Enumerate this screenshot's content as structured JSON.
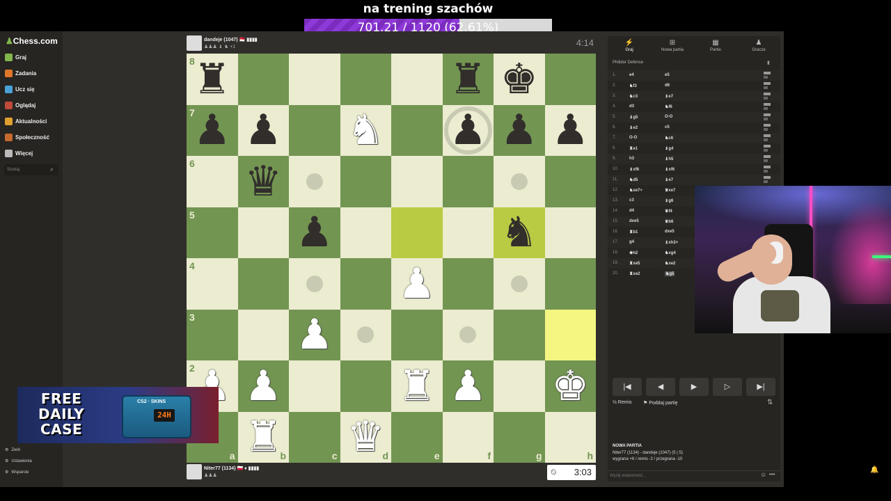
{
  "goal": {
    "title": "na trening szachów",
    "text": "701.21 / 1120 (62.61%)",
    "progress_fraction": 0.6261
  },
  "sidebar": {
    "logo": "Chess.com",
    "items": [
      {
        "label": "Graj",
        "icon": "play-icon",
        "color": "#81b64c"
      },
      {
        "label": "Zadania",
        "icon": "puzzle-icon",
        "color": "#e0762a"
      },
      {
        "label": "Ucz się",
        "icon": "learn-icon",
        "color": "#4aa3d8"
      },
      {
        "label": "Oglądaj",
        "icon": "watch-icon",
        "color": "#c04a3a"
      },
      {
        "label": "Aktualności",
        "icon": "news-icon",
        "color": "#e0a030"
      },
      {
        "label": "Społeczność",
        "icon": "social-icon",
        "color": "#c46a2e"
      },
      {
        "label": "Więcej",
        "icon": "more-icon",
        "color": "#bbbbbb"
      }
    ],
    "search_placeholder": "Szukaj",
    "footer": [
      {
        "label": "Zwiń",
        "icon": "collapse-icon"
      },
      {
        "label": "Ustawienia",
        "icon": "settings-icon"
      },
      {
        "label": "Wsparcie",
        "icon": "help-icon"
      }
    ]
  },
  "top_player": {
    "name": "dandeje (1047) 🇲🇨 ▮▮▮▮",
    "captured": "♟♟♟ ♝ ♞ +1",
    "clock": "4:14"
  },
  "bottom_player": {
    "name": "Niter77 (1134) 🇵🇱 ♦ ▮▮▮▮",
    "captured": "♟♟♟",
    "clock": "3:03"
  },
  "board": {
    "ranks": [
      "8",
      "7",
      "6",
      "5",
      "4",
      "3",
      "2",
      "1"
    ],
    "files": [
      "a",
      "b",
      "c",
      "d",
      "e",
      "f",
      "g",
      "h"
    ],
    "rows": [
      [
        "br",
        "",
        "",
        "",
        "",
        "br",
        "bk",
        ""
      ],
      [
        "bp",
        "bp",
        "",
        "wn",
        "",
        "bp",
        "bp",
        "bp"
      ],
      [
        "",
        "bq",
        "",
        "",
        "",
        "",
        "",
        ""
      ],
      [
        "",
        "",
        "bp",
        "",
        "",
        "",
        "bn",
        ""
      ],
      [
        "",
        "",
        "",
        "",
        "wp",
        "",
        "",
        ""
      ],
      [
        "",
        "",
        "wp",
        "",
        "",
        "",
        "",
        ""
      ],
      [
        "wp",
        "wp",
        "",
        "",
        "wr",
        "wp",
        "",
        "wk"
      ],
      [
        "",
        "wr",
        "",
        "wq",
        "",
        "",
        "",
        ""
      ]
    ],
    "highlights": [
      [
        "5",
        "e",
        "hl-dark"
      ],
      [
        "5",
        "g",
        "hl-dark"
      ],
      [
        "3",
        "h",
        "hl-light"
      ]
    ],
    "dots": [
      [
        "6",
        "c"
      ],
      [
        "6",
        "g"
      ],
      [
        "4",
        "c"
      ],
      [
        "4",
        "g"
      ],
      [
        "3",
        "d"
      ],
      [
        "3",
        "f"
      ]
    ],
    "rings": [
      [
        "7",
        "f"
      ]
    ]
  },
  "panel": {
    "tabs": [
      {
        "label": "Graj",
        "icon": "bolt-icon"
      },
      {
        "label": "Nowa partia",
        "icon": "plus-icon"
      },
      {
        "label": "Partie",
        "icon": "games-icon"
      },
      {
        "label": "Gracze",
        "icon": "players-icon"
      }
    ],
    "opening": "Philidor Defense",
    "moves": [
      [
        "1.",
        "e4",
        "e5"
      ],
      [
        "2.",
        "♞f3",
        "d6"
      ],
      [
        "3.",
        "♞c3",
        "♝e7"
      ],
      [
        "4.",
        "d3",
        "♞f6"
      ],
      [
        "5.",
        "♝g5",
        "O-O"
      ],
      [
        "6.",
        "♝e2",
        "c5"
      ],
      [
        "7.",
        "O-O",
        "♞c6"
      ],
      [
        "8.",
        "♜e1",
        "♝g4"
      ],
      [
        "9.",
        "h3",
        "♝h5"
      ],
      [
        "10.",
        "♝xf6",
        "♝xf6"
      ],
      [
        "11.",
        "♞d5",
        "♝e7"
      ],
      [
        "12.",
        "♞xe7+",
        "♛xe7"
      ],
      [
        "13.",
        "c3",
        "♝g6"
      ],
      [
        "14.",
        "d4",
        "♛f4"
      ],
      [
        "15.",
        "dxe5",
        "♛b6"
      ],
      [
        "16.",
        "♜b1",
        "dxe5"
      ],
      [
        "17.",
        "g4",
        "♝xh3+"
      ],
      [
        "18.",
        "♚h2",
        "♞xg4"
      ],
      [
        "19.",
        "♜xe5",
        "♞xe2"
      ],
      [
        "20.",
        "♜xe2",
        "♞g5"
      ]
    ],
    "nav": [
      "|◀",
      "◀",
      "▶",
      "▷",
      "▶|"
    ],
    "draw_label": "½ Remis",
    "resign_label": "⚑ Poddaj partię",
    "newgame_title": "NOWA PARTIA",
    "newgame_players": "Niter77 (1134) - dandeje (1047) (5 | 5)",
    "newgame_score": "wygrana +6 / remis -2 / przegrana -10",
    "chat_placeholder": "Wyślij wiadomość..."
  },
  "ad": {
    "line1": "FREE",
    "line2": "DAILY",
    "line3": "CASE",
    "lcd": "24H",
    "tag": "CS2 · SKINS"
  }
}
